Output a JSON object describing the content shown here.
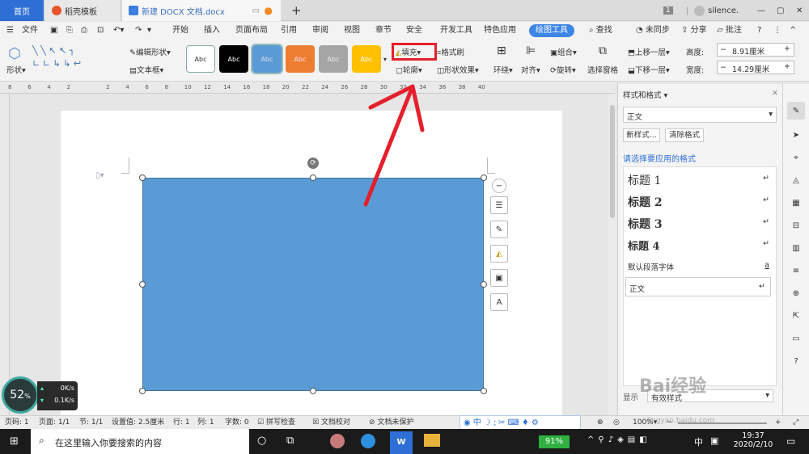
{
  "titlebar": {
    "home_tab": "首页",
    "template_tab": "稻壳模板",
    "doc_tab": "新建 DOCX 文档.docx",
    "new_tab": "+",
    "page_count_badge": "1",
    "username": "silence."
  },
  "menubar": {
    "file": "文件",
    "items": [
      "开始",
      "插入",
      "页面布局",
      "引用",
      "审阅",
      "视图",
      "章节",
      "安全",
      "开发工具",
      "特色应用"
    ],
    "active_tab": "绘图工具",
    "search": "查找",
    "sync": "未同步",
    "share": "分享",
    "comment": "批注"
  },
  "ribbon": {
    "shape_label": "形状",
    "edit_shape": "编辑形状",
    "text_box": "文本框",
    "style_label": "Abc",
    "fill": "填充",
    "outline": "轮廓",
    "format_brush": "格式刷",
    "shape_effect": "形状效果",
    "wrap": "环绕",
    "align": "对齐",
    "group": "组合",
    "rotate": "旋转",
    "select_pane": "选择窗格",
    "bring_forward": "上移一层",
    "send_backward": "下移一层",
    "height_label": "高度:",
    "height_value": "8.91厘米",
    "width_label": "宽度:",
    "width_value": "14.29厘米",
    "style_colors": [
      "#ffffff",
      "#000000",
      "#5b9bd5",
      "#ed7d31",
      "#a5a5a5",
      "#ffc000"
    ]
  },
  "ruler": {
    "ticks": [
      "8",
      "6",
      "4",
      "2",
      "",
      "2",
      "4",
      "6",
      "8",
      "10",
      "12",
      "14",
      "16",
      "18",
      "20",
      "22",
      "24",
      "26",
      "28",
      "30",
      "32",
      "34",
      "36",
      "38",
      "40"
    ]
  },
  "panel": {
    "title": "样式和格式",
    "current_style": "正文",
    "new_style_btn": "新样式...",
    "clear_format_btn": "清除格式",
    "prompt": "请选择要应用的格式",
    "styles": [
      "标题  1",
      "标题  2",
      "标题  3",
      "标题  4"
    ],
    "default_font": "默认段落字体",
    "body_style": "正文",
    "show_label": "显示",
    "show_value": "有效样式"
  },
  "statusbar": {
    "page_code": "页码: 1",
    "page": "页面: 1/1",
    "section": "节: 1/1",
    "setting": "设置值: 2.5厘米",
    "row": "行: 1",
    "col": "列: 1",
    "words": "字数: 0",
    "spell": "拼写检查",
    "proof": "文档校对",
    "protect": "文档未保护",
    "zoom": "100%"
  },
  "perf": {
    "cpu": "52",
    "cpu_unit": "%",
    "up": "0K/s",
    "down": "0.1K/s"
  },
  "taskbar": {
    "search_placeholder": "在这里输入你要搜索的内容",
    "battery": "91%",
    "ime": "中",
    "time": "19:37",
    "date": "2020/2/10",
    "watermark": "Bai经验",
    "watermark_url": "jingyan.baidu.com"
  }
}
